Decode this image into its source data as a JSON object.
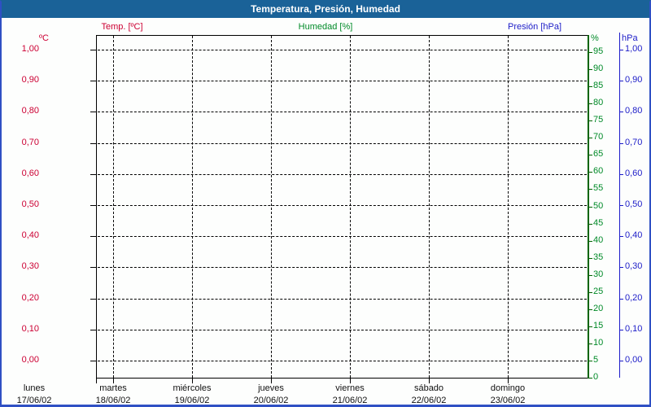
{
  "title_bar": {
    "text": "Temperatura, Presión, Humedad"
  },
  "legend": {
    "items": [
      {
        "label": "Temp. [ºC]",
        "color": "#CC0033",
        "x": 148
      },
      {
        "label": "Humedad [%]",
        "color": "#008A28",
        "x": 398
      },
      {
        "label": "Presión [hPa]",
        "color": "#1C1CC8",
        "x": 655
      }
    ]
  },
  "axes": {
    "left_temp": {
      "unit": "ºC",
      "color": "#CC0033",
      "labels": [
        "1,00",
        "0,90",
        "0,80",
        "0,70",
        "0,60",
        "0,50",
        "0,40",
        "0,30",
        "0,20",
        "0,10",
        "0,00"
      ]
    },
    "right_humidity": {
      "unit": "%",
      "color": "#008A28",
      "axis_line_color": "#006400",
      "labels": [
        "95",
        "90",
        "85",
        "80",
        "75",
        "70",
        "65",
        "60",
        "55",
        "50",
        "45",
        "40",
        "35",
        "30",
        "25",
        "20",
        "15",
        "10",
        "5",
        "0"
      ]
    },
    "right_pressure": {
      "unit": "hPa",
      "color": "#1C1CC8",
      "labels": [
        "1,00",
        "0,90",
        "0,80",
        "0,70",
        "0,60",
        "0,50",
        "0,40",
        "0,30",
        "0,20",
        "0,10",
        "0,00"
      ]
    },
    "x_days": [
      {
        "name": "lunes",
        "date": "17/06/02"
      },
      {
        "name": "martes",
        "date": "18/06/02"
      },
      {
        "name": "miércoles",
        "date": "19/06/02"
      },
      {
        "name": "jueves",
        "date": "20/06/02"
      },
      {
        "name": "viernes",
        "date": "21/06/02"
      },
      {
        "name": "sábado",
        "date": "22/06/02"
      },
      {
        "name": "domingo",
        "date": "23/06/02"
      }
    ]
  },
  "colors": {
    "titlebar_bg": "#1A6298",
    "page_border": "#2F50C4",
    "grid": "#000000"
  },
  "chart_data": {
    "type": "line",
    "title": "Temperatura, Presión, Humedad",
    "x_categories": [
      "lunes 17/06/02",
      "martes 18/06/02",
      "miércoles 19/06/02",
      "jueves 20/06/02",
      "viernes 21/06/02",
      "sábado 22/06/02",
      "domingo 23/06/02"
    ],
    "series": [
      {
        "name": "Temp. [ºC]",
        "axis": "left",
        "values": []
      },
      {
        "name": "Humedad [%]",
        "axis": "right-percent",
        "values": []
      },
      {
        "name": "Presión [hPa]",
        "axis": "right-hpa",
        "values": []
      }
    ],
    "note": "chart area is empty - no data plotted",
    "left_axis": {
      "label": "ºC",
      "min": 0.0,
      "max": 1.0,
      "step": 0.1
    },
    "right_axis_percent": {
      "label": "%",
      "min": 0,
      "max": 100,
      "step": 5
    },
    "right_axis_hpa": {
      "label": "hPa",
      "min": 0.0,
      "max": 1.0,
      "step": 0.1
    },
    "grid": true,
    "legend_position": "top"
  }
}
